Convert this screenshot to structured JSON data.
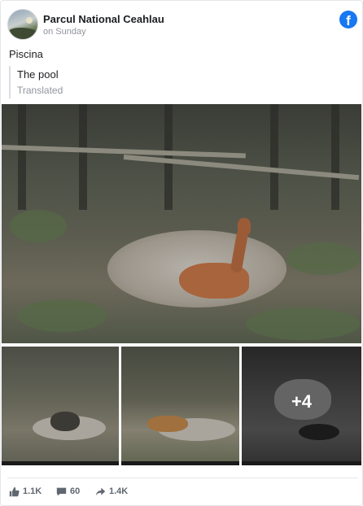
{
  "post": {
    "page_name": "Parcul National Ceahlau",
    "time": "on Sunday",
    "text": "Piscina",
    "translation": "The pool",
    "translated_label": "Translated",
    "more_photos": "+4"
  },
  "stats": {
    "likes": "1.1K",
    "comments": "60",
    "shares": "1.4K"
  },
  "icons": {
    "brand": "facebook-logo-icon",
    "like": "thumbs-up-icon",
    "comment": "comment-bubble-icon",
    "share": "share-arrow-icon"
  },
  "colors": {
    "brand": "#1877f2",
    "secondary_text": "#90949c",
    "stat_text": "#606770"
  }
}
